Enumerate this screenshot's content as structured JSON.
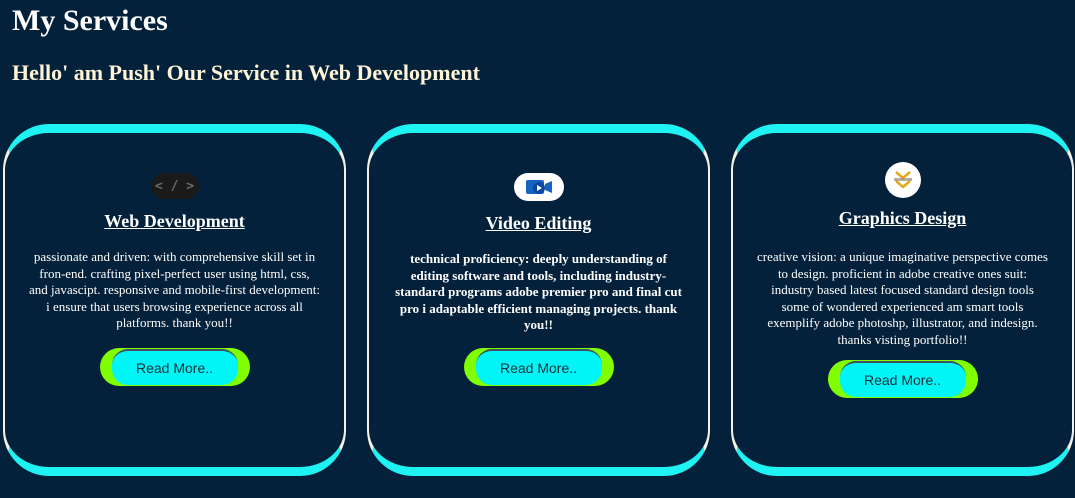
{
  "header": {
    "title": "My Services",
    "subtitle": "Hello' am Push' Our Service in Web Development"
  },
  "colors": {
    "background": "#03213a",
    "card_border_accent": "#1ef2f2",
    "button_outer": "#7fff00",
    "button_inner": "#00f6f6"
  },
  "services": [
    {
      "icon": "code-icon",
      "icon_text": "< / >",
      "title": "Web Development",
      "description": "passionate and driven: with comprehensive skill set in fron-end. crafting pixel-perfect user using html, css, and javascipt. responsive and mobile-first development: i ensure that users browsing experience across all platforms. thank you!!",
      "button_label": "Read More.."
    },
    {
      "icon": "video-editing-icon",
      "title": "Video Editing",
      "description": "technical proficiency: deeply understanding of editing software and tools, including industry-standard programs adobe premier pro and final cut pro i adaptable efficient managing projects. thank you!!",
      "button_label": "Read More.."
    },
    {
      "icon": "graphics-design-logo-icon",
      "title": "Graphics Design",
      "description": "creative vision: a unique imaginative perspective comes to design. proficient in adobe creative ones suit: industry based latest focused standard design tools some of wondered experienced am smart tools exemplify adobe photoshp, illustrator, and indesign. thanks visting portfolio!!",
      "button_label": "Read More.."
    }
  ]
}
